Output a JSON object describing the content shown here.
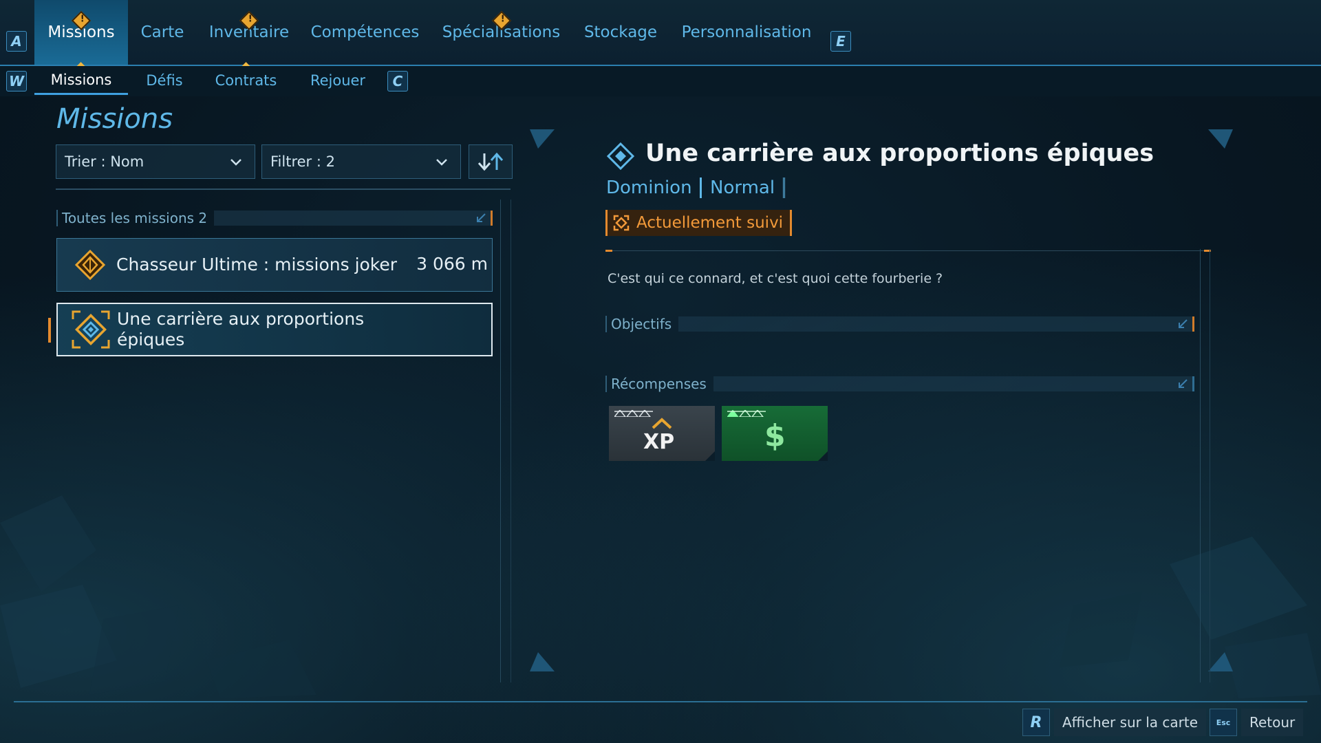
{
  "top_nav": {
    "left_key": "A",
    "right_key": "E",
    "tabs": [
      {
        "label": "Missions",
        "active": true,
        "alert": true
      },
      {
        "label": "Carte",
        "active": false,
        "alert": false
      },
      {
        "label": "Inventaire",
        "active": false,
        "alert": true
      },
      {
        "label": "Compétences",
        "active": false,
        "alert": false
      },
      {
        "label": "Spécialisations",
        "active": false,
        "alert": true
      },
      {
        "label": "Stockage",
        "active": false,
        "alert": false
      },
      {
        "label": "Personnalisation",
        "active": false,
        "alert": false
      }
    ]
  },
  "sub_nav": {
    "left_key": "W",
    "right_key": "C",
    "tabs": [
      {
        "label": "Missions",
        "active": true
      },
      {
        "label": "Défis",
        "active": false
      },
      {
        "label": "Contrats",
        "active": false
      },
      {
        "label": "Rejouer",
        "active": false
      }
    ]
  },
  "missions_panel": {
    "heading": "Missions",
    "sort_label": "Trier : Nom",
    "filter_label": "Filtrer : 2",
    "group_label": "Toutes les missions 2",
    "items": [
      {
        "name": "Chasseur Ultime : missions joker",
        "distance": "3 066 m",
        "icon": "joker-mission-icon",
        "selected": false
      },
      {
        "name": "Une carrière aux proportions épiques",
        "distance": "",
        "icon": "tracked-mission-icon",
        "selected": true
      }
    ]
  },
  "detail": {
    "title": "Une carrière aux proportions épiques",
    "faction": "Dominion",
    "difficulty": "Normal",
    "tracked_label": "Actuellement suivi",
    "description": "C'est qui ce connard, et c'est quoi cette fourberie ?",
    "objectives_label": "Objectifs",
    "rewards_label": "Récompenses",
    "rewards": [
      {
        "type": "XP",
        "icon": "xp-reward-icon"
      },
      {
        "type": "money",
        "icon": "dollar-reward-icon"
      }
    ]
  },
  "footer": {
    "map_key": "R",
    "map_label": "Afficher sur la carte",
    "back_key": "Esc",
    "back_label": "Retour"
  },
  "colors": {
    "accent_blue": "#5fb8e8",
    "accent_orange": "#e48a2e",
    "active_tab": "#1a6b96",
    "money_green": "#176c37"
  }
}
